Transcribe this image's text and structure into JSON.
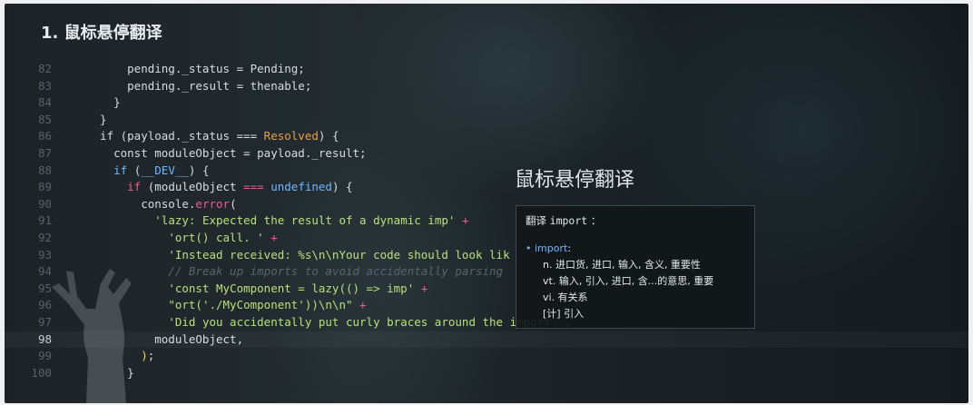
{
  "section_title": "1. 鼠标悬停翻译",
  "code": {
    "active_line": "98",
    "lines": [
      {
        "n": "82",
        "html": "      pending._status = Pending;"
      },
      {
        "n": "83",
        "html": "      pending._result = thenable;"
      },
      {
        "n": "84",
        "html": "    }"
      },
      {
        "n": "85",
        "html": "  }"
      },
      {
        "n": "86",
        "html": "  if (payload._status === <span class=\"o\">Resolved</span>) {"
      },
      {
        "n": "87",
        "html": "    const moduleObject = payload._result;"
      },
      {
        "n": "88",
        "html": "    <span class=\"b\">if</span> (<span class=\"b\">__DEV__</span>) {"
      },
      {
        "n": "89",
        "html": "      <span class=\"p\">if</span> (moduleObject <span class=\"p\">===</span> <span class=\"b\">undefined</span>) {"
      },
      {
        "n": "90",
        "html": "        console.<span class=\"p\">error</span>("
      },
      {
        "n": "91",
        "html": "          <span class=\"s\">'lazy: Expected the result of a dynamic imp'</span> <span class=\"p\">+</span>"
      },
      {
        "n": "92",
        "html": "            <span class=\"s\">'ort() call. '</span> <span class=\"p\">+</span>"
      },
      {
        "n": "93",
        "html": "            <span class=\"s\">'Instead received: %s\\n\\nYour code should look lik</span>"
      },
      {
        "n": "94",
        "html": "            <span class=\"c\">// Break up imports to avoid accidentally parsing</span>"
      },
      {
        "n": "95",
        "html": "            <span class=\"s\">'const MyComponent = lazy(() =&gt; imp'</span> <span class=\"p\">+</span>"
      },
      {
        "n": "96",
        "html": "            <span class=\"s\">\"ort('./MyComponent'))\\n\\n\"</span> <span class=\"p\">+</span>"
      },
      {
        "n": "97",
        "html": "            <span class=\"s\">'Did you accidentally put curly braces around the import?'</span>,"
      },
      {
        "n": "98",
        "html": "          moduleObject,"
      },
      {
        "n": "99",
        "html": "        <span class=\"y\">)</span>;"
      },
      {
        "n": "100",
        "html": "      }"
      }
    ]
  },
  "panel_heading": "鼠标悬停翻译",
  "translation": {
    "head_label": "翻译",
    "head_word": "import",
    "head_colon": "：",
    "entry_word": "import",
    "entry_colon": ":",
    "definitions": [
      "n. 进口货, 进口, 输入, 含义, 重要性",
      "vt. 输入, 引入, 进口, 含...的意思, 重要",
      "vi. 有关系",
      "[计] 引入"
    ]
  },
  "colors": {
    "string": "#b8e07c",
    "keyword_pink": "#ec5d8e",
    "keyword_blue": "#6db7ff",
    "constant_orange": "#e6a14b",
    "comment": "#59656c",
    "popup_bg": "#12171a"
  }
}
